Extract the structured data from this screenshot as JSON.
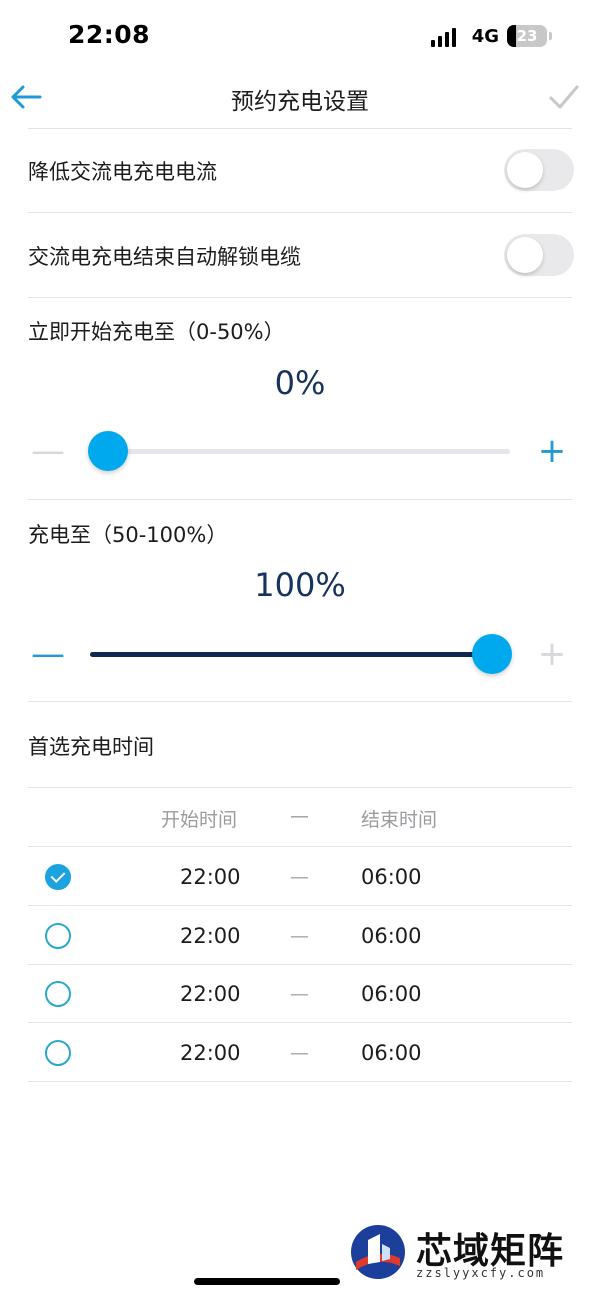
{
  "status_bar": {
    "time": "22:08",
    "network": "4G",
    "battery": "23"
  },
  "nav": {
    "title": "预约充电设置",
    "back_icon": "arrow-left-icon",
    "confirm_icon": "check-icon"
  },
  "settings": {
    "reduce_ac_current": {
      "label": "降低交流电充电电流",
      "on": false
    },
    "auto_unlock_cable": {
      "label": "交流电充电结束自动解锁电缆",
      "on": false
    }
  },
  "immediate_charge": {
    "label": "立即开始充电至（0-50%）",
    "value_text": "0%",
    "value": 0,
    "min": 0,
    "max": 50,
    "minus": "—",
    "plus": "+"
  },
  "charge_to": {
    "label": "充电至（50-100%）",
    "value_text": "100%",
    "value": 100,
    "min": 50,
    "max": 100,
    "minus": "—",
    "plus": "+"
  },
  "preferred_time": {
    "label": "首选充电时间",
    "headers": {
      "start": "开始时间",
      "sep": "—",
      "end": "结束时间"
    },
    "rows": [
      {
        "selected": true,
        "start": "22:00",
        "sep": "—",
        "end": "06:00"
      },
      {
        "selected": false,
        "start": "22:00",
        "sep": "—",
        "end": "06:00"
      },
      {
        "selected": false,
        "start": "22:00",
        "sep": "—",
        "end": "06:00"
      },
      {
        "selected": false,
        "start": "22:00",
        "sep": "—",
        "end": "06:00"
      }
    ]
  },
  "watermark": {
    "title": "芯域矩阵",
    "url": "zzslyyxcfy.com"
  },
  "colors": {
    "accent": "#00a9ee",
    "navy": "#0f2850",
    "value_text": "#17325c",
    "divider": "#e4e4e7"
  }
}
